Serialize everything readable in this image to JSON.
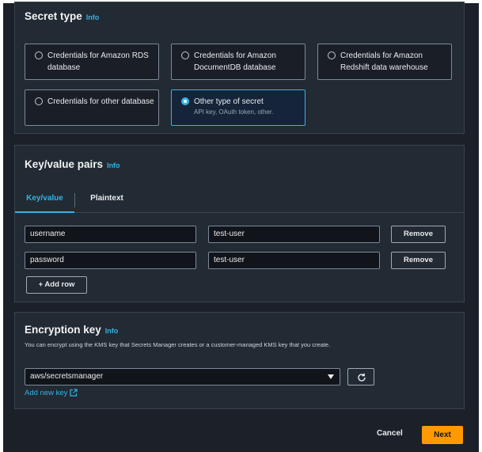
{
  "secret_type": {
    "title": "Secret type",
    "info": "Info",
    "options": [
      {
        "label": "Credentials for Amazon RDS database",
        "description": "",
        "selected": false
      },
      {
        "label": "Credentials for Amazon DocumentDB database",
        "description": "",
        "selected": false
      },
      {
        "label": "Credentials for Amazon Redshift data warehouse",
        "description": "",
        "selected": false
      },
      {
        "label": "Credentials for other database",
        "description": "",
        "selected": false
      },
      {
        "label": "Other type of secret",
        "description": "API key, OAuth token, other.",
        "selected": true
      }
    ]
  },
  "key_value": {
    "title": "Key/value pairs",
    "info": "Info",
    "tabs": [
      {
        "label": "Key/value",
        "active": true
      },
      {
        "label": "Plaintext",
        "active": false
      }
    ],
    "rows": [
      {
        "key": "username",
        "value": "test-user",
        "remove_label": "Remove"
      },
      {
        "key": "password",
        "value": "test-user",
        "remove_label": "Remove"
      }
    ],
    "add_row_label": "+ Add row"
  },
  "encryption": {
    "title": "Encryption key",
    "info": "Info",
    "description": "You can encrypt using the KMS key that Secrets Manager creates or a customer-managed KMS key that you create.",
    "selected_key": "aws/secretsmanager",
    "add_new_key_label": "Add new key"
  },
  "footer": {
    "cancel_label": "Cancel",
    "next_label": "Next"
  },
  "colors": {
    "accent": "#33b4e4",
    "primary_button": "#ff9900",
    "panel_bg": "#222a33"
  }
}
